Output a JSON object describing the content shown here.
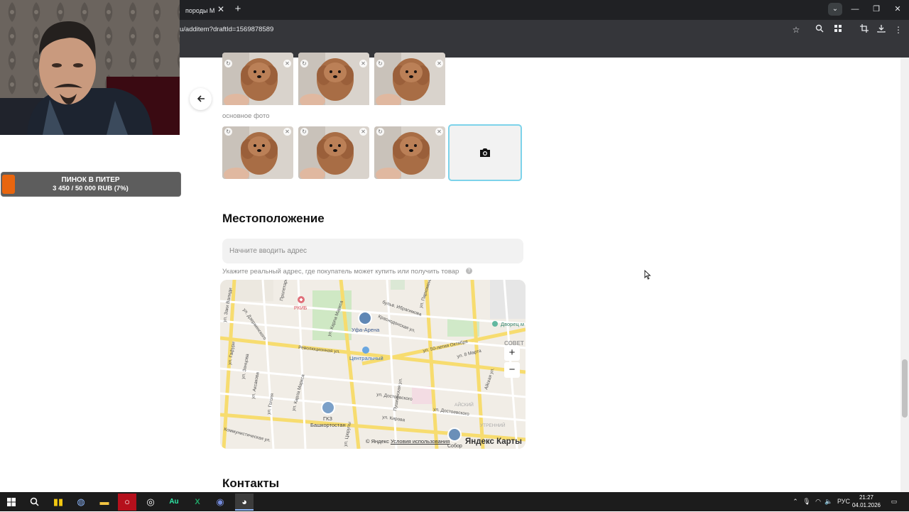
{
  "browser": {
    "tab_title": "породы М",
    "tab_close": "✕",
    "new_tab": "+",
    "url": "u/additem?draftId=1569878589",
    "window_controls": {
      "minimize": "—",
      "restore": "❐",
      "close": "✕"
    }
  },
  "stream": {
    "goal_title": "ПИНОК В ПИТЕР",
    "goal_progress": "3 450 / 50 000 RUB (7%)",
    "goal_fraction": 0.07,
    "goal_color": "#e8650e"
  },
  "photos": {
    "main_photo_label": "основное фото",
    "add_photo_icon": "camera-icon"
  },
  "location": {
    "title": "Местоположение",
    "address_placeholder": "Начните вводить адрес",
    "address_value": "",
    "hint": "Укажите реальный адрес, где покупатель может купить или получить товар",
    "map": {
      "labels": {
        "rkib": "РКИБ",
        "ufa_arena": "Уфа-Арена",
        "centralny": "Центральный",
        "gkz": "ГКЗ",
        "bashkortostan": "Башкортостан",
        "dvorets": "Дворец м",
        "sovet": "СОВЕТ",
        "aiskiy": "АЙСКИЙ",
        "utrenniy": "УТРЕННИЙ",
        "sobor": "Собор"
      },
      "streets": {
        "s1": "бульв. Ибрагимова",
        "s2": "Краснодонская ул.",
        "s3": "Революционная ул.",
        "s4": "ул. 50-летия Октября",
        "s5": "ул. 8 Марта",
        "s6": "ул. Достоевского",
        "s7": "ул. Кирова",
        "s8": "Коммунистическая ул.",
        "s9": "ул. Карла Маркса",
        "s10": "ул. Цюрупы",
        "s11": "ул. Дзержинского",
        "s12": "ул. Гоголя",
        "s13": "ул. Аксакова",
        "s14": "ул. Зенцова",
        "s15": "ул. Гафури",
        "s16": "Айская ул.",
        "s17": "ул. Пархоменко",
        "s18": "Пушкинская ул.",
        "s19": "Пролетарская ул.",
        "s20": "ул. Заки Валиди"
      },
      "zoom_in": "+",
      "zoom_out": "−",
      "copyright": "© Яндекс",
      "terms": "Условия использования",
      "logo": "Яндекс Карты"
    }
  },
  "contacts": {
    "title": "Контакты"
  },
  "taskbar": {
    "language": "РУС",
    "time": "21:27",
    "date": "04.01.2026"
  },
  "colors": {
    "accent_border": "#7dd3ea",
    "chrome_dark": "#202124",
    "taskbar": "#1c1c1c"
  }
}
